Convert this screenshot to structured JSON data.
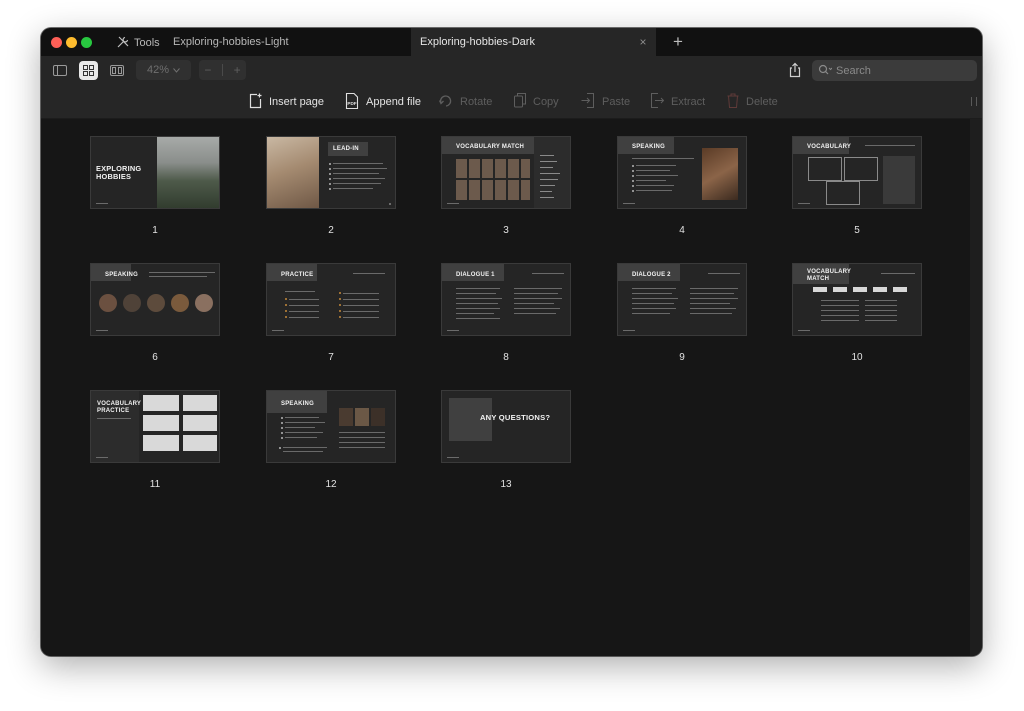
{
  "window": {
    "tools_label": "Tools",
    "tabs": [
      {
        "label": "Exploring-hobbies-Light",
        "active": false
      },
      {
        "label": "Exploring-hobbies-Dark",
        "active": true
      }
    ],
    "tab_close_symbol": "×",
    "new_tab_symbol": "+"
  },
  "toolbar": {
    "zoom": "42%",
    "zoom_minus": "−",
    "zoom_plus": "+",
    "search_placeholder": "Search",
    "view_icons": [
      "sidebar-view-icon",
      "grid-view-icon",
      "page-view-icon"
    ]
  },
  "actions": [
    {
      "label": "Insert page",
      "enabled": true
    },
    {
      "label": "Append file",
      "enabled": true
    },
    {
      "label": "Rotate",
      "enabled": false
    },
    {
      "label": "Copy",
      "enabled": false
    },
    {
      "label": "Paste",
      "enabled": false
    },
    {
      "label": "Extract",
      "enabled": false
    },
    {
      "label": "Delete",
      "enabled": false
    }
  ],
  "slides": [
    {
      "number": "1",
      "title": "EXPLORING HOBBIES"
    },
    {
      "number": "2",
      "title": "LEAD-IN"
    },
    {
      "number": "3",
      "title": "VOCABULARY MATCH"
    },
    {
      "number": "4",
      "title": "SPEAKING"
    },
    {
      "number": "5",
      "title": "VOCABULARY"
    },
    {
      "number": "6",
      "title": "SPEAKING"
    },
    {
      "number": "7",
      "title": "PRACTICE"
    },
    {
      "number": "8",
      "title": "DIALOGUE 1"
    },
    {
      "number": "9",
      "title": "DIALOGUE 2"
    },
    {
      "number": "10",
      "title": "VOCABULARY MATCH"
    },
    {
      "number": "11",
      "title": "VOCABULARY PRACTICE"
    },
    {
      "number": "12",
      "title": "SPEAKING"
    },
    {
      "number": "13",
      "title": "ANY QUESTIONS?"
    }
  ],
  "colors": {
    "window_bg": "#161616",
    "toolbar_bg": "#262626",
    "slide_bg": "#252525",
    "slide_band": "#404040",
    "text": "#e4e4e4",
    "disabled": "#5e5e5e",
    "close": "#fe5f57",
    "minimize": "#febc2e",
    "zoom": "#28c840"
  }
}
